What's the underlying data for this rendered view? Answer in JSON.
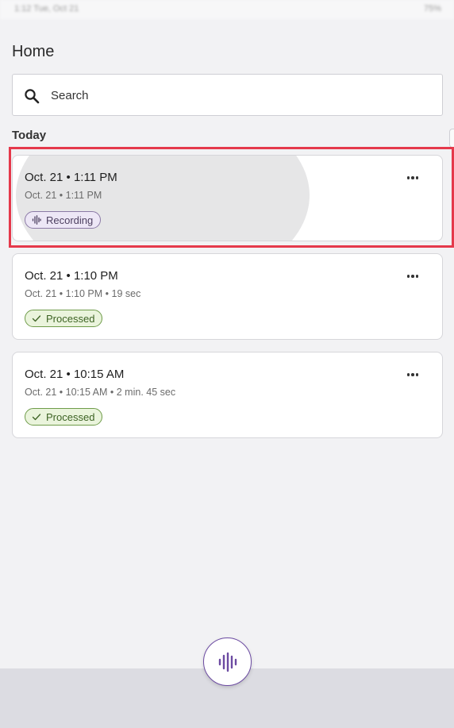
{
  "status_bar": {
    "left_text": "1:12  Tue, Oct 21",
    "right_text": "75%"
  },
  "header": {
    "title": "Home"
  },
  "search": {
    "placeholder": "Search"
  },
  "section": {
    "heading": "Today"
  },
  "recordings": [
    {
      "title": "Oct. 21 • 1:11 PM",
      "subtitle": "Oct. 21 • 1:11 PM",
      "status": "Recording",
      "status_icon": "waveform-icon",
      "status_color": "#ede7f6"
    },
    {
      "title": "Oct. 21 • 1:10 PM",
      "subtitle": "Oct. 21 • 1:10 PM • 19 sec",
      "status": "Processed",
      "status_icon": "check-icon",
      "status_color": "#eaf4dc"
    },
    {
      "title": "Oct. 21 • 10:15 AM",
      "subtitle": "Oct. 21 • 10:15 AM • 2 min. 45 sec",
      "status": "Processed",
      "status_icon": "check-icon",
      "status_color": "#eaf4dc"
    }
  ],
  "fab": {
    "icon": "waveform-icon",
    "accent_color": "#6c4ba2"
  },
  "highlight_color": "#e5394b"
}
